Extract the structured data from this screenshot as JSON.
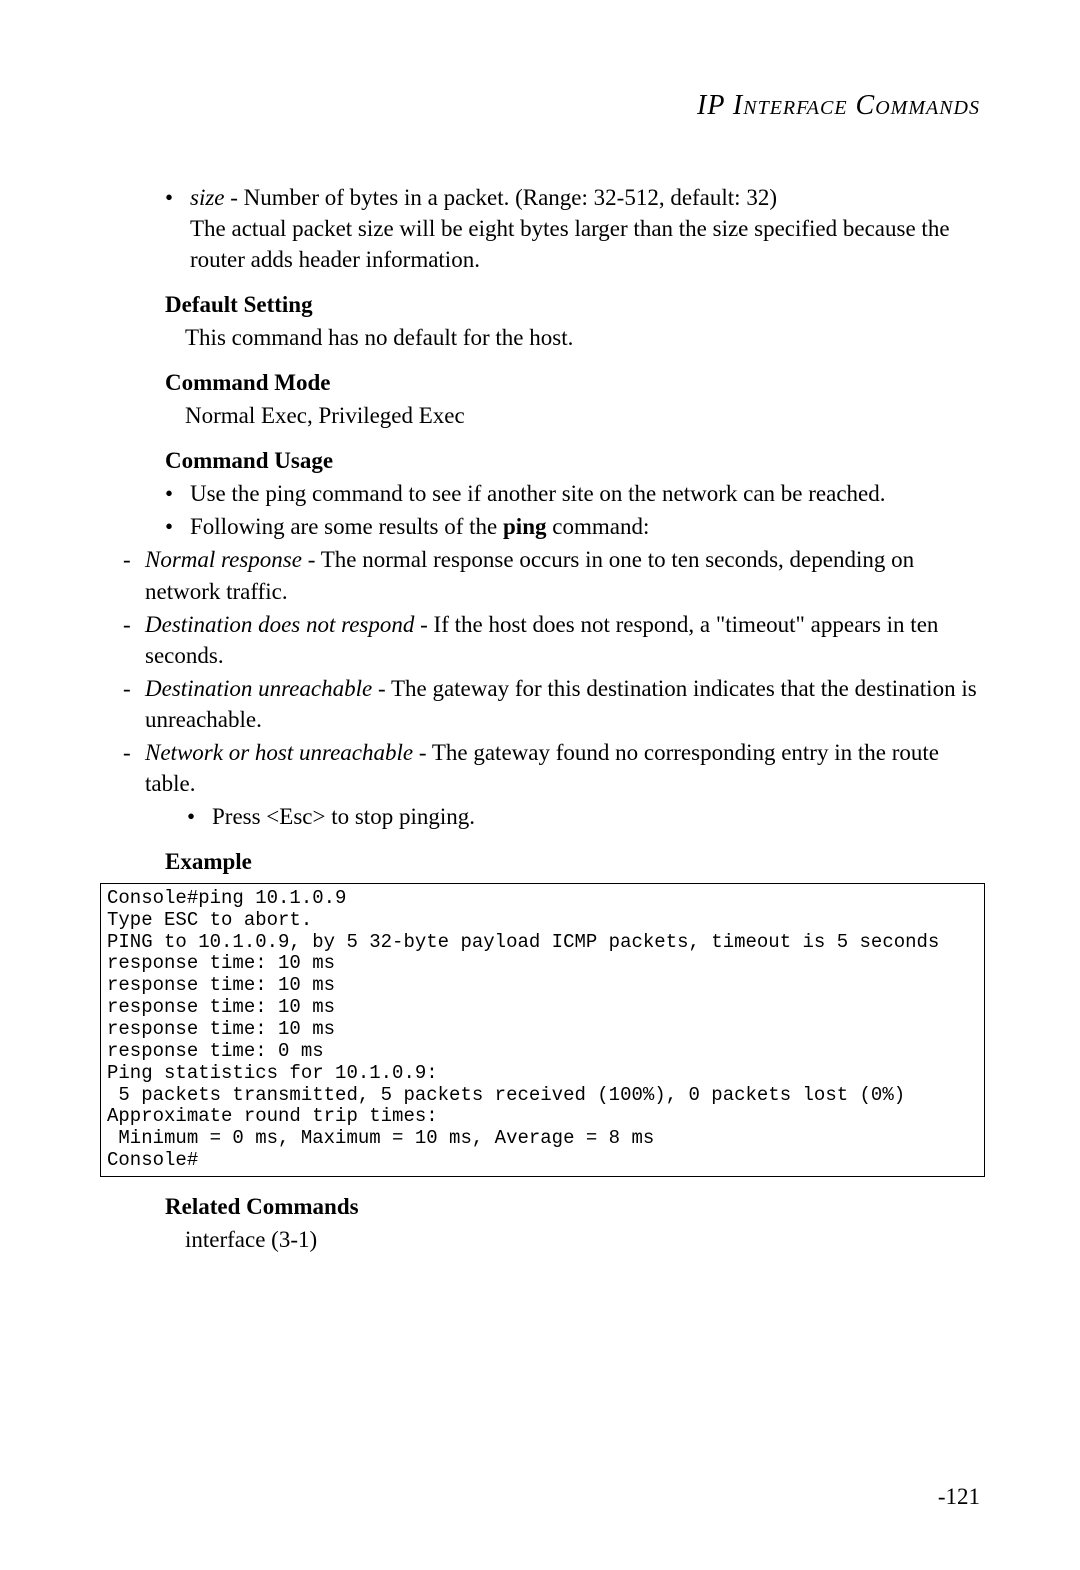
{
  "header": "IP Interface Commands",
  "size_bullet": {
    "label": "size",
    "text1": " - Number of bytes in a packet. (Range: 32-512, default: 32)",
    "text2": "The actual packet size will be eight bytes larger than the size specified because the router adds header information."
  },
  "sections": {
    "default_setting": {
      "heading": "Default Setting",
      "body": "This command has no default for the host."
    },
    "command_mode": {
      "heading": "Command Mode",
      "body": "Normal Exec, Privileged Exec"
    },
    "command_usage": {
      "heading": "Command Usage",
      "bullet1": "Use the ping command to see if another site on the network can be reached.",
      "bullet2a": "Following are some results of the ",
      "bullet2b": "ping",
      "bullet2c": " command:",
      "dash1_i": "Normal response",
      "dash1_t": " - The normal response occurs in one to ten seconds, depending on network traffic.",
      "dash2_i": "Destination does not respond",
      "dash2_t": " - If the host does not respond, a \"timeout\" appears in ten seconds.",
      "dash3_i": "Destination unreachable",
      "dash3_t": " - The gateway for this destination indicates that the destination is unreachable.",
      "dash4_i": "Network or host unreachable",
      "dash4_t": " - The gateway found no corresponding entry in the route table.",
      "bullet3": "Press <Esc> to stop pinging."
    },
    "example": {
      "heading": "Example",
      "code": "Console#ping 10.1.0.9\nType ESC to abort.\nPING to 10.1.0.9, by 5 32-byte payload ICMP packets, timeout is 5 seconds\nresponse time: 10 ms\nresponse time: 10 ms\nresponse time: 10 ms\nresponse time: 10 ms\nresponse time: 0 ms\nPing statistics for 10.1.0.9:\n 5 packets transmitted, 5 packets received (100%), 0 packets lost (0%)\nApproximate round trip times:\n Minimum = 0 ms, Maximum = 10 ms, Average = 8 ms\nConsole#"
    },
    "related": {
      "heading": "Related Commands",
      "body": "interface (3-1)"
    }
  },
  "page_number": "-121"
}
